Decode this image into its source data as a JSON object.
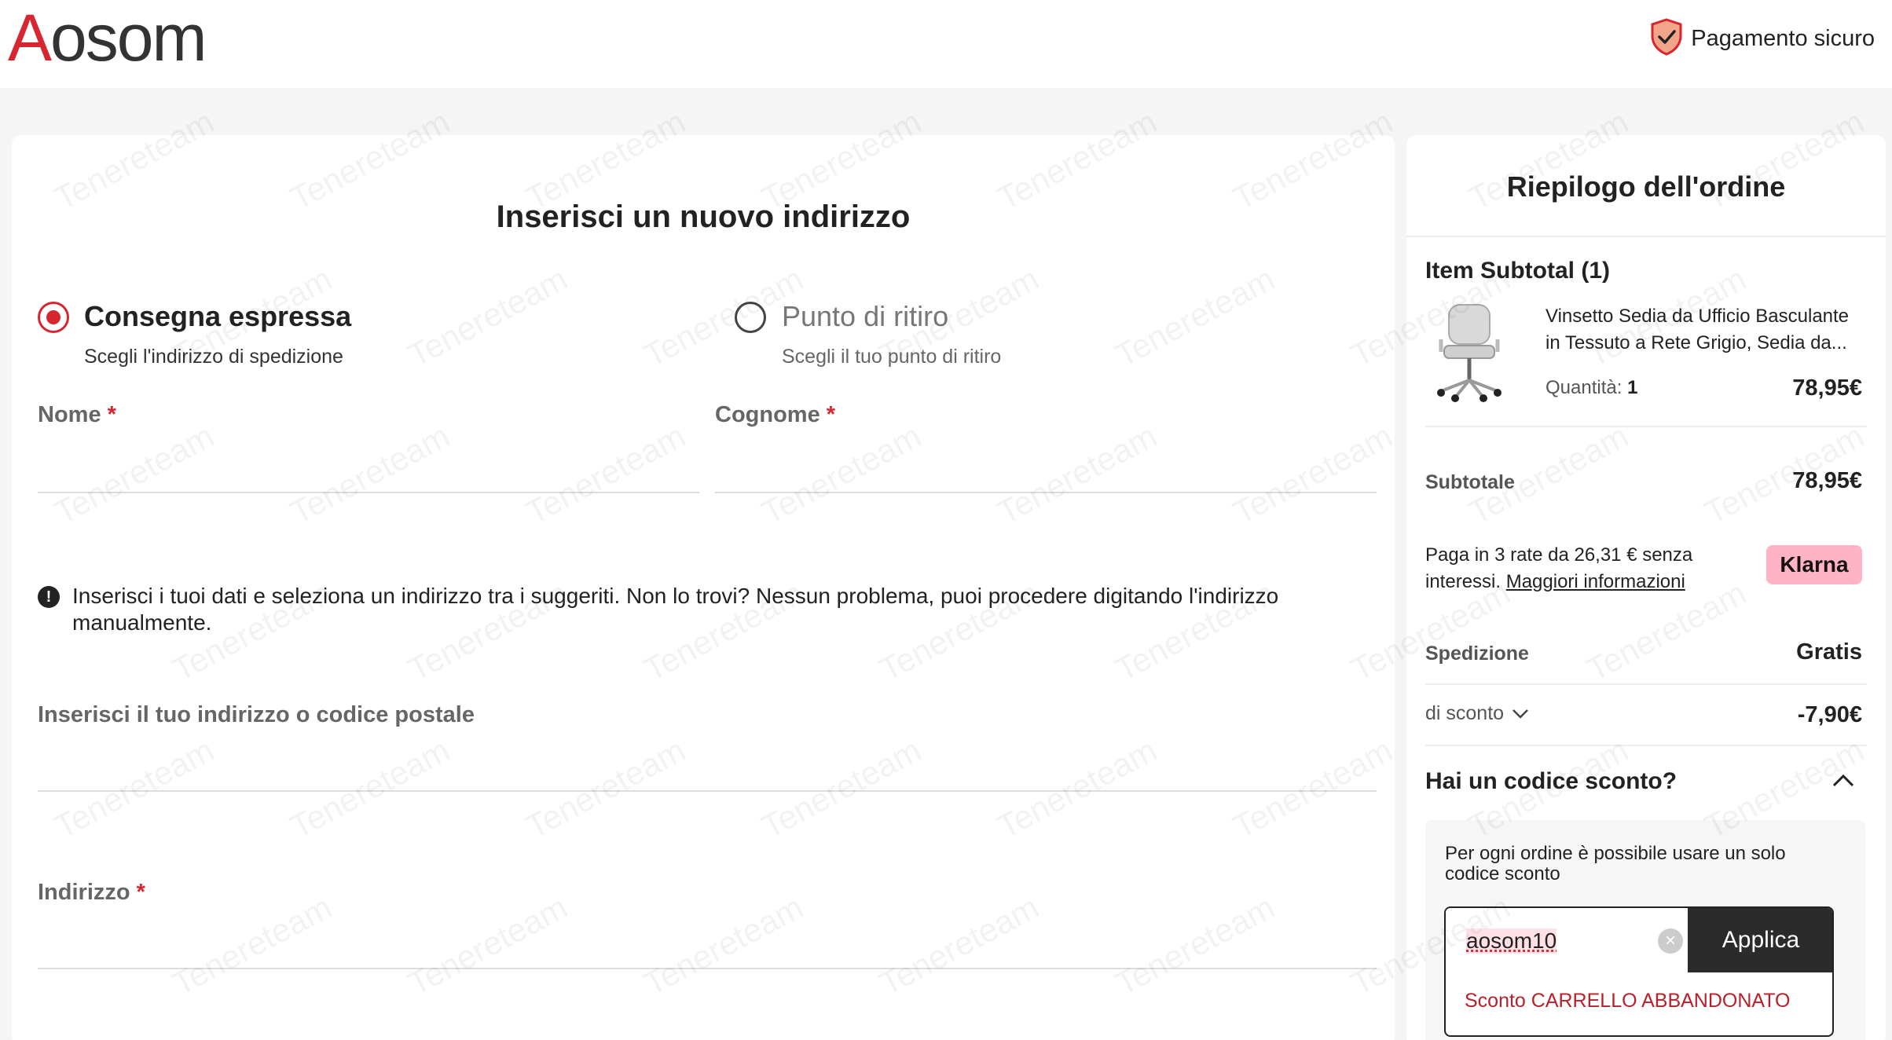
{
  "header": {
    "logo_first": "A",
    "logo_rest": "osom",
    "secure_label": "Pagamento sicuro",
    "secure_icon": "shield-check-icon"
  },
  "form": {
    "title": "Inserisci un nuovo indirizzo",
    "delivery_options": [
      {
        "title": "Consegna espressa",
        "subtitle": "Scegli l'indirizzo di spedizione",
        "selected": true
      },
      {
        "title": "Punto di ritiro",
        "subtitle": "Scegli il tuo punto di ritiro",
        "selected": false
      }
    ],
    "fields": {
      "first_name": {
        "label": "Nome",
        "required": "*",
        "value": ""
      },
      "last_name": {
        "label": "Cognome",
        "required": "*",
        "value": ""
      },
      "address_search": {
        "label": "Inserisci il tuo indirizzo o codice postale",
        "value": ""
      },
      "address": {
        "label": "Indirizzo",
        "required": "*",
        "value": ""
      }
    },
    "info_message": "Inserisci i tuoi dati e seleziona un indirizzo tra i suggeriti. Non lo trovi? Nessun problema, puoi procedere digitando l'indirizzo manualmente.",
    "info_icon": "!"
  },
  "summary": {
    "title": "Riepilogo dell'ordine",
    "item_subtotal_label": "Item Subtotal (1)",
    "product": {
      "name": "Vinsetto Sedia da Ufficio Basculante in Tessuto a Rete Grigio, Sedia da...",
      "quantity_label": "Quantità:",
      "quantity": "1",
      "price": "78,95€"
    },
    "subtotal_label": "Subtotale",
    "subtotal_value": "78,95€",
    "klarna_text": "Paga in 3 rate da 26,31 € senza interessi.",
    "klarna_link": "Maggiori informazioni",
    "klarna_badge": "Klarna",
    "shipping_label": "Spedizione",
    "shipping_value": "Gratis",
    "discount_label": "di sconto",
    "discount_value": "-7,90€",
    "code_heading": "Hai un codice sconto?",
    "code_note": "Per ogni ordine è possibile usare un solo codice sconto",
    "code_value": "aosom10",
    "apply_label": "Applica",
    "suggestion": "Sconto CARRELLO ABBANDONATO"
  },
  "colors": {
    "brand_red": "#d7262f",
    "klarna_pink": "#ffb3c7",
    "apply_dark": "#2b2b2b"
  },
  "watermark": "Tenereteam"
}
